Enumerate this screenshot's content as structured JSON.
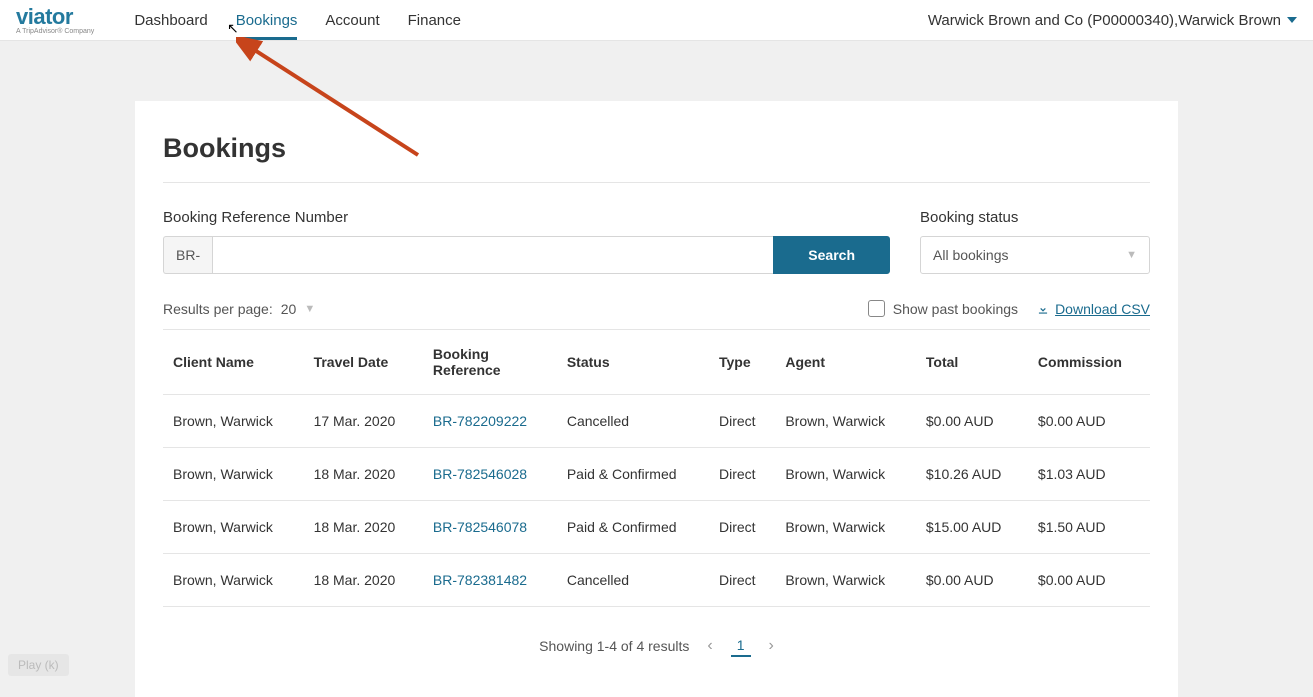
{
  "brand": {
    "name": "viator",
    "tagline": "A TripAdvisor® Company"
  },
  "nav": {
    "items": [
      {
        "label": "Dashboard",
        "id": "dashboard"
      },
      {
        "label": "Bookings",
        "id": "bookings",
        "active": true
      },
      {
        "label": "Account",
        "id": "account"
      },
      {
        "label": "Finance",
        "id": "finance"
      }
    ],
    "account_label": "Warwick Brown and Co (P00000340),Warwick Brown"
  },
  "page": {
    "title": "Bookings"
  },
  "search": {
    "ref_label": "Booking Reference Number",
    "ref_prefix": "BR-",
    "ref_value": "",
    "button_label": "Search",
    "status_label": "Booking status",
    "status_selected": "All bookings"
  },
  "controls": {
    "results_per_page_label": "Results per page:",
    "results_per_page_value": "20",
    "show_past_label": "Show past bookings",
    "show_past_checked": false,
    "download_label": "Download CSV"
  },
  "table": {
    "columns": [
      "Client Name",
      "Travel Date",
      "Booking Reference",
      "Status",
      "Type",
      "Agent",
      "Total",
      "Commission"
    ],
    "rows": [
      {
        "client": "Brown, Warwick",
        "date": "17 Mar. 2020",
        "ref": "BR-782209222",
        "status": "Cancelled",
        "type": "Direct",
        "agent": "Brown, Warwick",
        "total": "$0.00 AUD",
        "commission": "$0.00 AUD"
      },
      {
        "client": "Brown, Warwick",
        "date": "18 Mar. 2020",
        "ref": "BR-782546028",
        "status": "Paid & Confirmed",
        "type": "Direct",
        "agent": "Brown, Warwick",
        "total": "$10.26 AUD",
        "commission": "$1.03 AUD"
      },
      {
        "client": "Brown, Warwick",
        "date": "18 Mar. 2020",
        "ref": "BR-782546078",
        "status": "Paid & Confirmed",
        "type": "Direct",
        "agent": "Brown, Warwick",
        "total": "$15.00 AUD",
        "commission": "$1.50 AUD"
      },
      {
        "client": "Brown, Warwick",
        "date": "18 Mar. 2020",
        "ref": "BR-782381482",
        "status": "Cancelled",
        "type": "Direct",
        "agent": "Brown, Warwick",
        "total": "$0.00 AUD",
        "commission": "$0.00 AUD"
      }
    ]
  },
  "pagination": {
    "summary": "Showing 1-4 of 4 results",
    "current_page": "1"
  },
  "overlay": {
    "play_hint": "Play (k)"
  }
}
